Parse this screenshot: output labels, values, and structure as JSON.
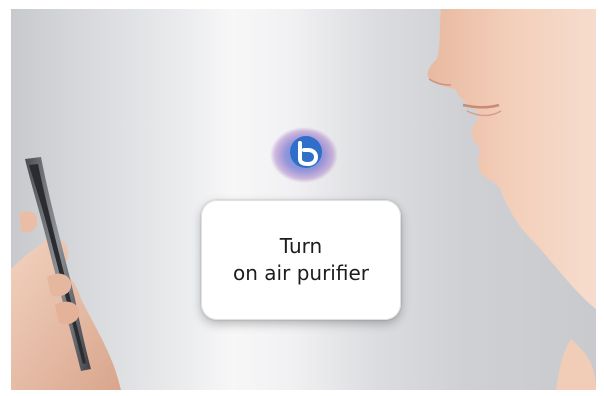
{
  "speech_bubble": {
    "line1": "Turn",
    "line2": "on air purifier"
  },
  "assistant_logo": {
    "icon": "bixby-logo-icon",
    "colors": {
      "badge_inner": "#2f6fc9",
      "glow_blue": "#4a8fe0",
      "glow_purple": "#8a4fb8"
    }
  },
  "colors": {
    "background_light": "#f7f7f8",
    "background_dark": "#c8c9cc",
    "bubble_background": "#ffffff",
    "bubble_text": "#1d1d1d"
  }
}
